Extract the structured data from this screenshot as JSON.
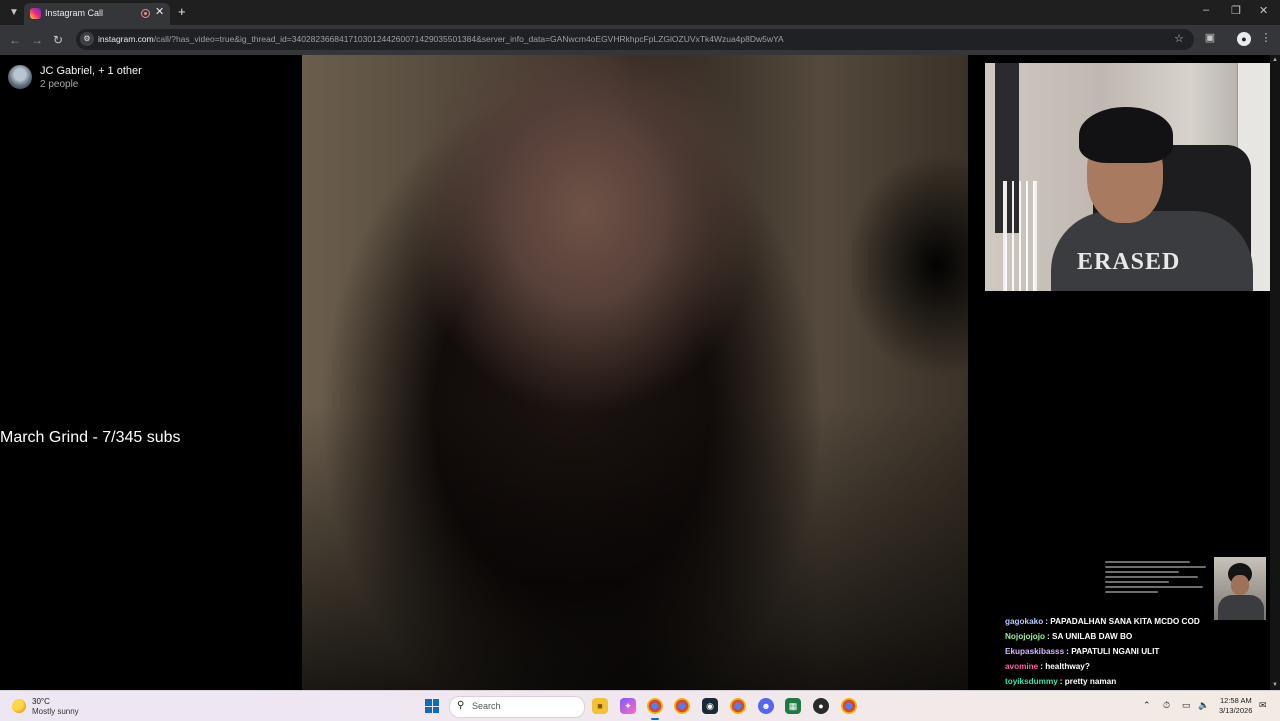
{
  "browser": {
    "tab_title": "Instagram Call",
    "url_host": "instagram.com",
    "url_path": "/call/?has_video=true&ig_thread_id=340282366841710301244260071429035501384&server_info_data=GANwcm4oEGVHRkhpcFpLZGlOZUVxTk4Wzua4p8Dw5wYA",
    "icons": {
      "tab_menu": "chevron-down-icon",
      "new_tab": "plus-icon",
      "back": "arrow-left-icon",
      "forward": "arrow-right-icon",
      "reload": "reload-icon",
      "bookmark": "star-icon",
      "extensions": "puzzle-icon",
      "menu": "kebab-icon"
    }
  },
  "call": {
    "title": "JC Gabriel, + 1 other",
    "participants": "2 people"
  },
  "overlay": {
    "goal": "March Grind - 7/345 subs"
  },
  "chat": [
    {
      "user": "gagokako",
      "message": "PAPADALHAN SANA KITA MCDO COD",
      "color": "#b9c7ff"
    },
    {
      "user": "Nojojojojo",
      "message": "SA UNILAB DAW BO",
      "color": "#9bf29b"
    },
    {
      "user": "Ekupaskibasss",
      "message": "PAPATULI NGANI ULIT",
      "color": "#d9b3ff"
    },
    {
      "user": "avomine",
      "message": "healthway?",
      "color": "#ff5ea8"
    },
    {
      "user": "toyiksdummy",
      "message": "pretty naman",
      "color": "#3fe0b0"
    }
  ],
  "taskbar": {
    "weather_temp": "30°C",
    "weather_condition": "Mostly sunny",
    "search_placeholder": "Search",
    "time": "12:58 AM",
    "date": "3/13/2026",
    "tray_icons": [
      "chevron-up-icon",
      "microphone-icon",
      "display-icon",
      "speaker-icon",
      "notification-icon"
    ]
  }
}
